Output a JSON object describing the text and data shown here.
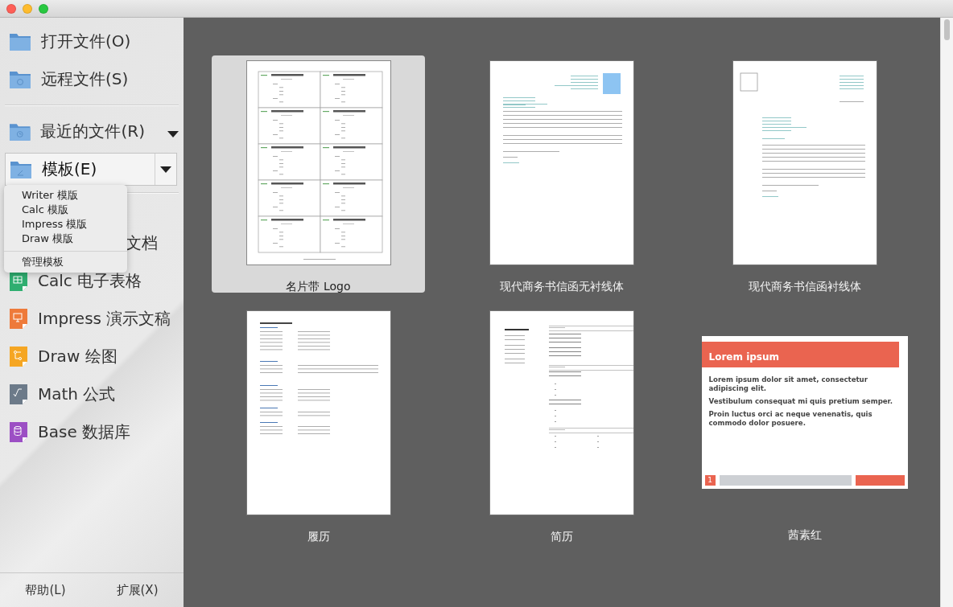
{
  "sidebar": {
    "actions": [
      {
        "label": "打开文件(O)",
        "kind": "folder"
      },
      {
        "label": "远程文件(S)",
        "kind": "remote"
      }
    ],
    "recent": {
      "label": "最近的文件(R)"
    },
    "templates": {
      "label": "模板(E)",
      "selected": true
    },
    "template_menu": {
      "items": [
        "Writer 模版",
        "Calc 模版",
        "Impress 模版",
        "Draw 模版"
      ],
      "manage": "管理模板"
    },
    "apps": [
      {
        "label": "文档",
        "covered": true
      },
      {
        "label": "Calc 电子表格",
        "kind": "calc",
        "covered": false
      },
      {
        "label": "Impress 演示文稿",
        "kind": "impress",
        "covered": false
      },
      {
        "label": "Draw 绘图",
        "kind": "draw",
        "covered": false
      },
      {
        "label": "Math 公式",
        "kind": "math",
        "covered": false
      },
      {
        "label": "Base 数据库",
        "kind": "base",
        "covered": false
      }
    ],
    "footer": [
      "帮助(L)",
      "扩展(X)"
    ]
  },
  "templates": [
    {
      "name": "名片带 Logo",
      "kind": "cards",
      "selected": true
    },
    {
      "name": "现代商务书信函无衬线体",
      "kind": "letter_right",
      "selected": false
    },
    {
      "name": "现代商务书信函衬线体",
      "kind": "letter_left",
      "selected": false
    },
    {
      "name": "履历",
      "kind": "cv",
      "selected": false
    },
    {
      "name": "简历",
      "kind": "resume",
      "selected": false
    },
    {
      "name": "茜素红",
      "kind": "slide",
      "selected": false,
      "slide": {
        "title": "Lorem ipsum",
        "lines": [
          "Lorem ipsum dolor sit amet, consectetur adipiscing elit.",
          "Vestibulum consequat mi quis pretium semper.",
          "Proin luctus orci ac neque venenatis, quis commodo dolor posuere."
        ],
        "page": "1"
      }
    }
  ]
}
